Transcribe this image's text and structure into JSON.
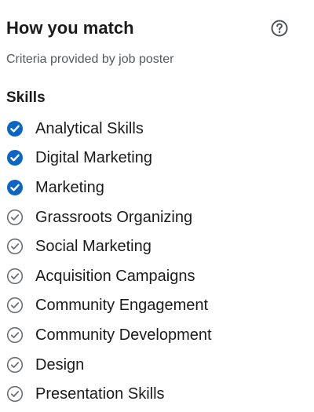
{
  "header": {
    "title": "How you match",
    "help_icon": "question-circle-icon"
  },
  "subtitle": "Criteria provided by job poster",
  "skills_section": {
    "title": "Skills",
    "items": [
      {
        "label": "Analytical Skills",
        "matched": true
      },
      {
        "label": "Digital Marketing",
        "matched": true
      },
      {
        "label": "Marketing",
        "matched": true
      },
      {
        "label": "Grassroots Organizing",
        "matched": false
      },
      {
        "label": "Social Marketing",
        "matched": false
      },
      {
        "label": "Acquisition Campaigns",
        "matched": false
      },
      {
        "label": "Community Engagement",
        "matched": false
      },
      {
        "label": "Community Development",
        "matched": false
      },
      {
        "label": "Design",
        "matched": false
      },
      {
        "label": "Presentation Skills",
        "matched": false
      }
    ]
  },
  "icons": {
    "matched": "check-circle-filled-icon",
    "unmatched": "check-circle-outline-icon"
  },
  "colors": {
    "matched_fill": "#0a66c2",
    "unmatched_stroke": "#6b6f73",
    "title_text": "#1b1b1b",
    "subtitle_text": "#555a5f"
  }
}
